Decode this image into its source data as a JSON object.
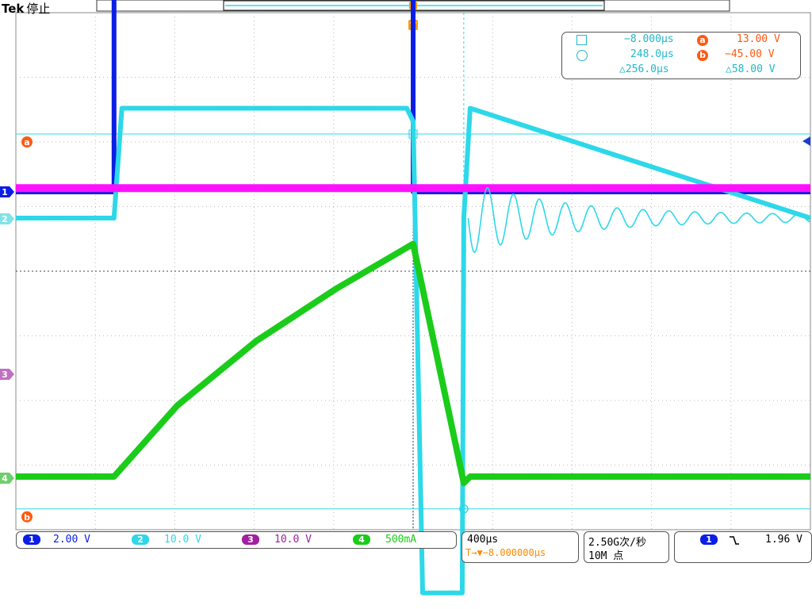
{
  "header": {
    "brand": "Tek",
    "state": "停止"
  },
  "trigger_marker": "T",
  "readouts": {
    "cursor1_time": "−8.000µs",
    "cursor2_time": "248.0µs",
    "delta_time": "△256.0µs",
    "cursor_a_label": "a",
    "cursor_a_value": "13.00 V",
    "cursor_b_label": "b",
    "cursor_b_value": "−45.00 V",
    "delta_value": "△58.00 V"
  },
  "channels": [
    {
      "num": "1",
      "scale": "2.00 V",
      "color": "#0a1ee6"
    },
    {
      "num": "2",
      "scale": "10.0 V",
      "color": "#2dd8e8"
    },
    {
      "num": "3",
      "scale": "10.0 V",
      "color": "#a020a0"
    },
    {
      "num": "4",
      "scale": "500mA",
      "color": "#1bcc1b"
    }
  ],
  "timebase": {
    "scale": "400µs",
    "trigger_pos": "T→▼−8.000000µs"
  },
  "acquisition": {
    "rate": "2.50G次/秒",
    "length": "10M 点"
  },
  "trigger_setup": {
    "source": "1",
    "slope": "falling-edge-icon",
    "level": "1.96 V"
  },
  "colors": {
    "grid": "#bbbbbb",
    "cursor": "#2dd8e8",
    "ch1": "#0a1ee6",
    "ch2": "#2dd8e8",
    "ch3": "#ff10ff",
    "ch4": "#1bcc1b",
    "cursor_badge": "#ff5a10"
  },
  "chart_data": {
    "type": "line",
    "xlabel": "",
    "ylabel": "",
    "grid": true,
    "divisions": {
      "x": 10,
      "y": 8
    },
    "x_unit": "µs",
    "xlim": [
      -2016,
      2000
    ],
    "series": [
      {
        "name": "1",
        "unit": "V",
        "volts_per_div": 2.0,
        "x": [
          -2016,
          -1520,
          -1520,
          -8,
          -8,
          2000
        ],
        "y": [
          0,
          0,
          6.6,
          6.6,
          0,
          0
        ]
      },
      {
        "name": "2",
        "unit": "V",
        "volts_per_div": 10.0,
        "x": [
          -2016,
          -1520,
          -1480,
          -40,
          -8,
          40,
          240,
          248,
          280,
          2000
        ],
        "y": [
          0,
          0,
          17,
          17,
          15,
          -58,
          -58,
          0,
          17,
          0
        ]
      },
      {
        "name": "3",
        "unit": "V",
        "volts_per_div": 10.0,
        "x": [
          -2016,
          2000
        ],
        "y": [
          18,
          18
        ]
      },
      {
        "name": "4",
        "unit": "A",
        "amps_per_div": 0.5,
        "x": [
          -2016,
          -1520,
          -1200,
          -800,
          -400,
          -8,
          248,
          280,
          2000
        ],
        "y": [
          0,
          0,
          0.55,
          1.05,
          1.45,
          1.8,
          -0.05,
          0,
          0
        ]
      }
    ],
    "cursors": {
      "t1": -8,
      "t2": 248,
      "va": 13,
      "vb": -45
    }
  }
}
